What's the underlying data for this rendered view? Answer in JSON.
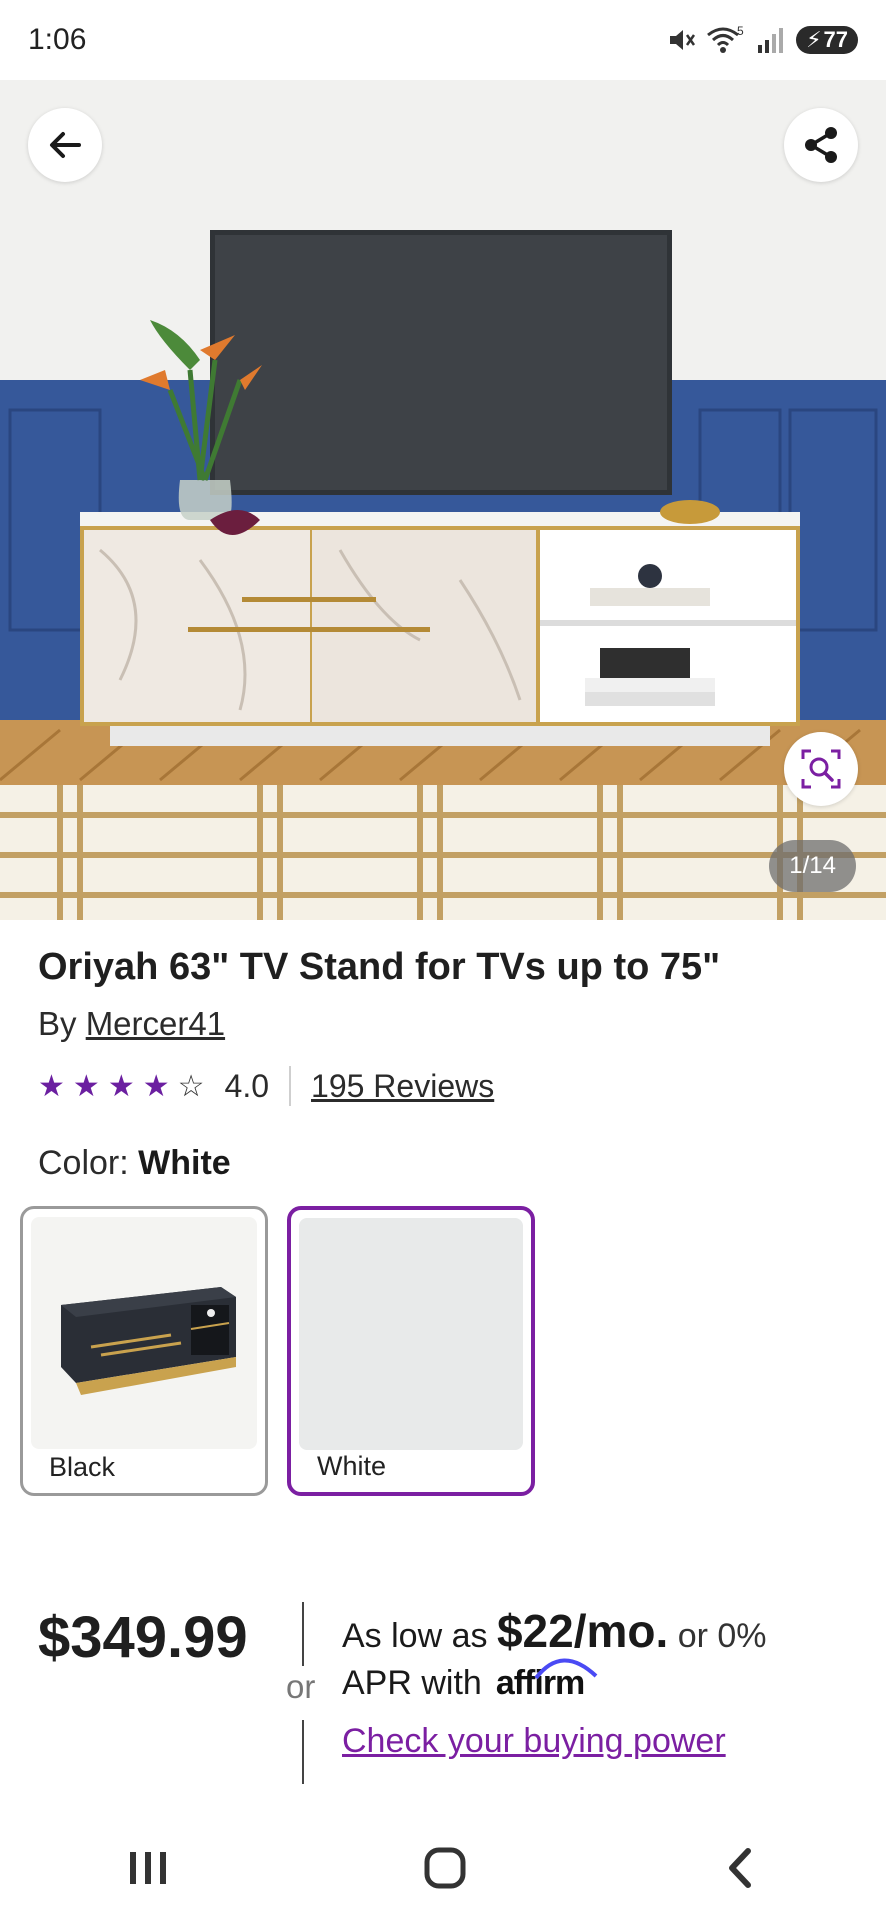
{
  "status_bar": {
    "time": "1:06",
    "battery": "77",
    "wifi_badge": "5"
  },
  "hero": {
    "page_counter": "1/14",
    "icons": {
      "back": "back-arrow-icon",
      "share": "share-icon",
      "visual_search": "visual-search-icon"
    }
  },
  "product": {
    "title": "Oriyah 63\" TV Stand for TVs up to 75\"",
    "by_prefix": "By",
    "brand": "Mercer41",
    "rating": "4.0",
    "rating_value": 4,
    "rating_max": 5,
    "reviews_label": "195 Reviews"
  },
  "color": {
    "label": "Color:",
    "selected": "White",
    "options": [
      {
        "label": "Black"
      },
      {
        "label": "White"
      }
    ]
  },
  "pricing": {
    "price": "$349.99",
    "or": "or",
    "as_low_as": "As low as",
    "monthly": "$22/mo.",
    "or_zero": "or 0%",
    "apr_with": "APR with",
    "affirm": "affirm",
    "buying_power": "Check your buying power"
  },
  "colors": {
    "accent": "#7b1fa2",
    "star": "#6b1fa0"
  }
}
